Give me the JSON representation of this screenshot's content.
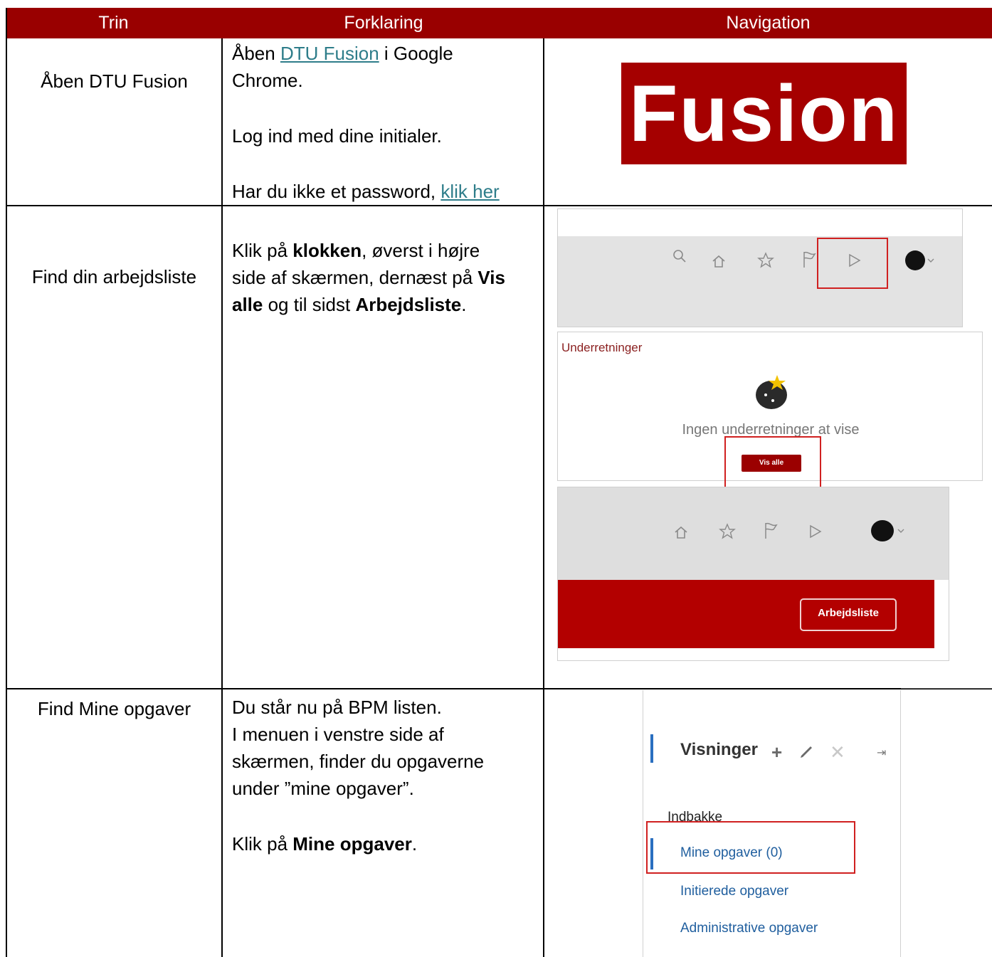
{
  "table": {
    "headers": [
      "Trin",
      "Forklaring",
      "Navigation"
    ],
    "rows": [
      {
        "step": "Åben DTU Fusion",
        "expl": {
          "line1_pre": "Åben ",
          "line1_link": "DTU Fusion",
          "line1_post": " i Google",
          "line2": "Chrome.",
          "line3": "Log ind med dine initialer.",
          "line4_pre": "Har du ikke et password, ",
          "line4_link": "klik her"
        },
        "logo_text": "Fusion"
      },
      {
        "step": "Find din arbejdsliste",
        "expl": {
          "t1": "Klik på ",
          "b1": "klokken",
          "t2": ", øverst i højre",
          "t3": "side af skærmen, dernæst på ",
          "b2a": "Vis",
          "b2b": "alle",
          "t4": " og til sidst ",
          "b3": "Arbejdsliste",
          "t5": "."
        },
        "notifications": {
          "title": "Underretninger",
          "empty_text": "Ingen underretninger at vise",
          "button": "Vis alle"
        },
        "worklist_button": "Arbejdsliste"
      },
      {
        "step": "Find Mine opgaver",
        "expl": {
          "l1": "Du står nu på BPM listen.",
          "l2": "I menuen i venstre side af",
          "l3": "skærmen, finder du opgaverne",
          "l4": "under ”mine opgaver”.",
          "l5_pre": "Klik på ",
          "l5_bold": "Mine opgaver",
          "l5_post": "."
        },
        "views": {
          "title": "Visninger",
          "section": "Indbakke",
          "items": [
            "Mine opgaver (0)",
            "Initierede opgaver",
            "Administrative opgaver"
          ]
        }
      }
    ]
  },
  "colors": {
    "header_bg": "#990000",
    "link": "#2e7d8a",
    "highlight": "#d02020"
  }
}
